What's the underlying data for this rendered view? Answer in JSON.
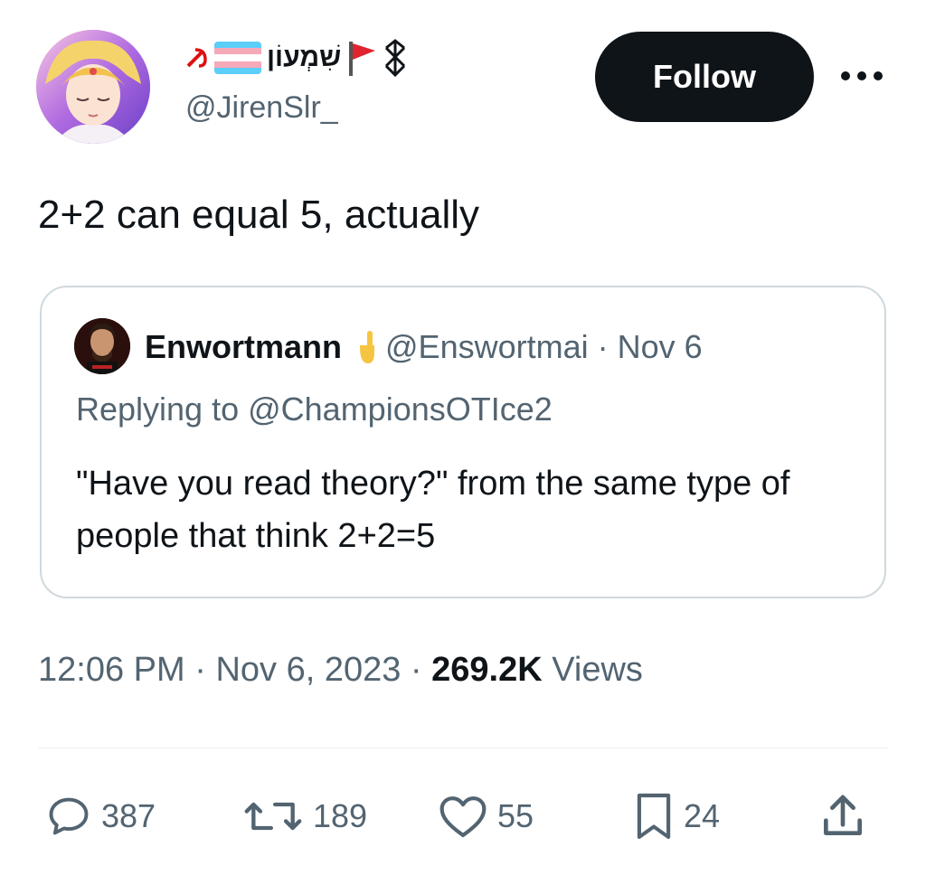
{
  "tweet": {
    "display_name": "שִׁמְעוֹן",
    "handle": "@JirenSlr_",
    "follow_label": "Follow",
    "more_label": "•••",
    "text": "2+2 can equal 5, actually"
  },
  "quote": {
    "name": "Enwortmann",
    "handle": "@Enswortmai",
    "date": "· Nov 6",
    "replying_to": "Replying to @ChampionsOTIce2",
    "text": "\"Have you read theory?\" from the same type of people that think 2+2=5"
  },
  "meta": {
    "time": "12:06 PM",
    "date": "Nov 6, 2023",
    "separator": "·",
    "views_count": "269.2K",
    "views_label": "Views"
  },
  "actions": {
    "replies": "387",
    "reposts": "189",
    "likes": "55",
    "bookmarks": "24"
  },
  "icons": [
    "hammer-sickle-icon",
    "trans-flag-icon",
    "red-flag-icon",
    "berserk-brand-icon",
    "more-icon",
    "reply-icon",
    "repost-icon",
    "like-icon",
    "bookmark-icon",
    "share-icon"
  ],
  "colors": {
    "text": "#0f1419",
    "secondary": "#536471",
    "border": "#cfd9de",
    "button": "#0f1419"
  }
}
